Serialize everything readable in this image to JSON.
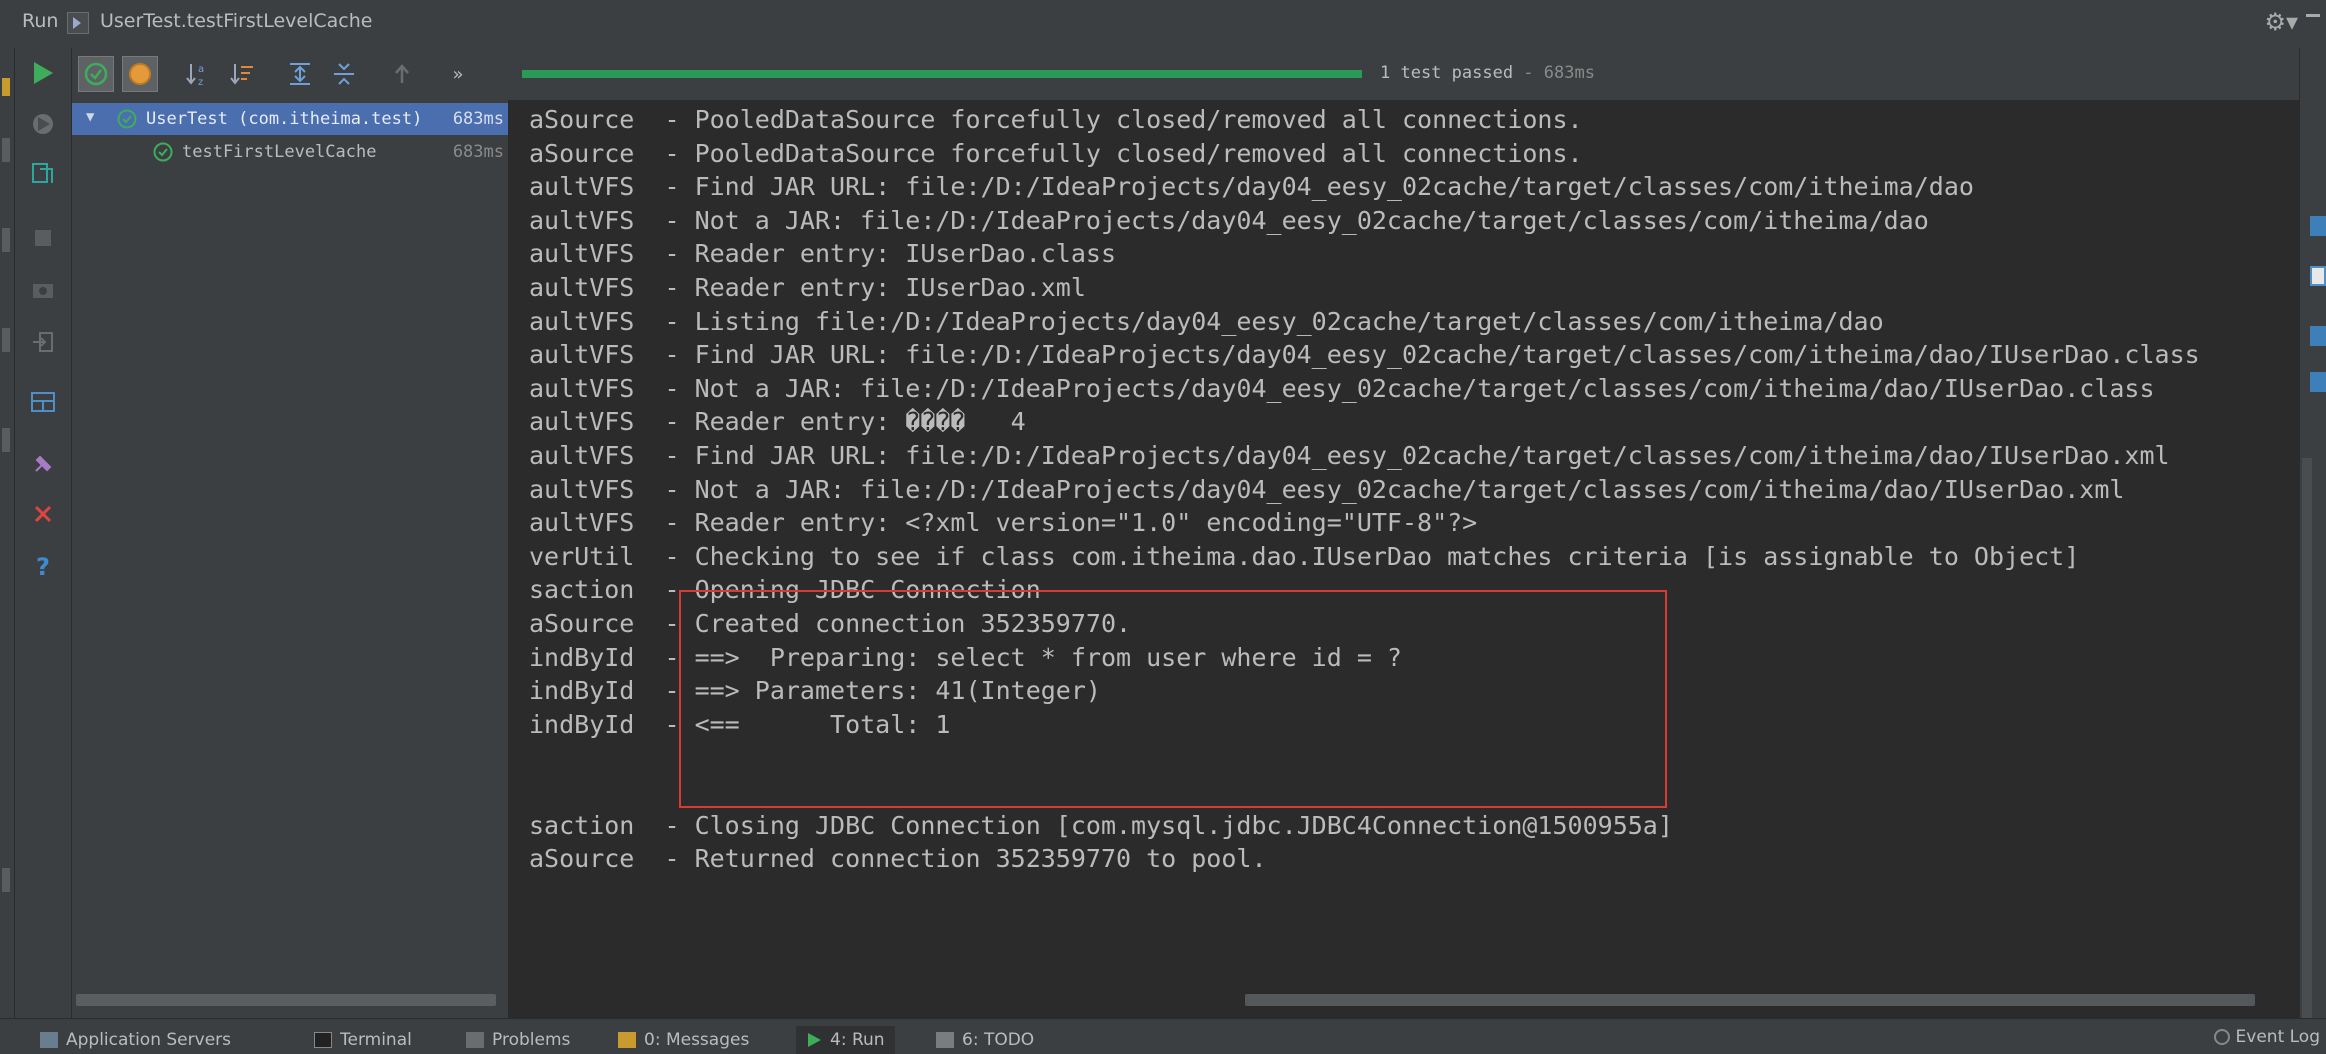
{
  "titlebar": {
    "run_label": "Run",
    "config_name": "UserTest.testFirstLevelCache",
    "settings_glyph": "⚙▾"
  },
  "toolbar": {
    "status": "1 test passed",
    "duration": " - 683ms",
    "progress_fraction": 1.0,
    "more_glyph": "»"
  },
  "tree": {
    "items": [
      {
        "name": "UserTest (com.itheima.test)",
        "duration": "683ms"
      },
      {
        "name": "testFirstLevelCache",
        "duration": "683ms"
      }
    ]
  },
  "console": {
    "lines": [
      "aSource  - PooledDataSource forcefully closed/removed all connections.",
      "aSource  - PooledDataSource forcefully closed/removed all connections.",
      "aultVFS  - Find JAR URL: file:/D:/IdeaProjects/day04_eesy_02cache/target/classes/com/itheima/dao",
      "aultVFS  - Not a JAR: file:/D:/IdeaProjects/day04_eesy_02cache/target/classes/com/itheima/dao",
      "aultVFS  - Reader entry: IUserDao.class",
      "aultVFS  - Reader entry: IUserDao.xml",
      "aultVFS  - Listing file:/D:/IdeaProjects/day04_eesy_02cache/target/classes/com/itheima/dao",
      "aultVFS  - Find JAR URL: file:/D:/IdeaProjects/day04_eesy_02cache/target/classes/com/itheima/dao/IUserDao.class",
      "aultVFS  - Not a JAR: file:/D:/IdeaProjects/day04_eesy_02cache/target/classes/com/itheima/dao/IUserDao.class",
      "aultVFS  - Reader entry: ����   4",
      "aultVFS  - Find JAR URL: file:/D:/IdeaProjects/day04_eesy_02cache/target/classes/com/itheima/dao/IUserDao.xml",
      "aultVFS  - Not a JAR: file:/D:/IdeaProjects/day04_eesy_02cache/target/classes/com/itheima/dao/IUserDao.xml",
      "aultVFS  - Reader entry: <?xml version=\"1.0\" encoding=\"UTF-8\"?>",
      "verUtil  - Checking to see if class com.itheima.dao.IUserDao matches criteria [is assignable to Object]",
      "saction  - Opening JDBC Connection",
      "aSource  - Created connection 352359770.",
      "indById  - ==>  Preparing: select * from user where id = ?",
      "indById  - ==> Parameters: 41(Integer)",
      "indById  - <==      Total: 1",
      "",
      "",
      "saction  - Closing JDBC Connection [com.mysql.jdbc.JDBC4Connection@1500955a]",
      "aSource  - Returned connection 352359770 to pool."
    ]
  },
  "bottom": {
    "tabs": [
      {
        "label": "Application Servers",
        "icon": "servers-icon"
      },
      {
        "label": "Terminal",
        "icon": "terminal-icon"
      },
      {
        "label": "Problems",
        "icon": "problems-icon"
      },
      {
        "label": "0: Messages",
        "icon": "messages-icon"
      },
      {
        "label": "4: Run",
        "icon": "run-icon"
      },
      {
        "label": "6: TODO",
        "icon": "todo-icon"
      }
    ],
    "event_log": "Event Log"
  }
}
